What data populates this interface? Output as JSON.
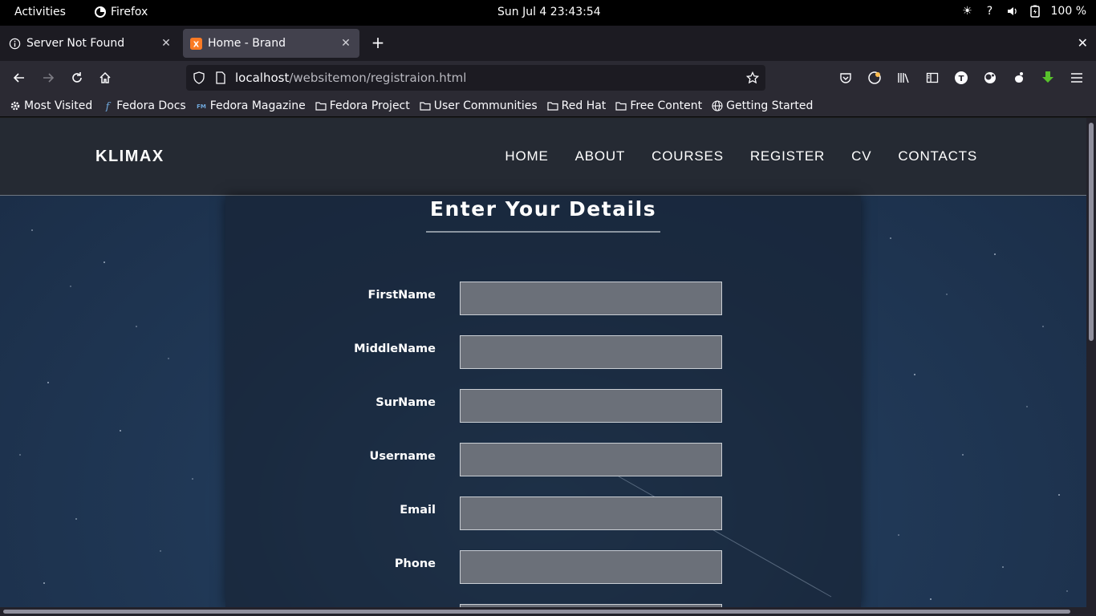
{
  "system_bar": {
    "activities": "Activities",
    "app_name": "Firefox",
    "clock": "Sun Jul 4  23:43:54",
    "battery": "100 %"
  },
  "browser": {
    "tabs": [
      {
        "title": "Server Not Found",
        "active": false
      },
      {
        "title": "Home - Brand",
        "active": true
      }
    ],
    "url_host": "localhost",
    "url_path": "/websitemon/registraion.html",
    "bookmarks": [
      {
        "label": "Most Visited",
        "icon": "gear-icon"
      },
      {
        "label": "Fedora Docs",
        "icon": "fedora-icon"
      },
      {
        "label": "Fedora Magazine",
        "icon": "fm-icon"
      },
      {
        "label": "Fedora Project",
        "icon": "folder-icon"
      },
      {
        "label": "User Communities",
        "icon": "folder-icon"
      },
      {
        "label": "Red Hat",
        "icon": "folder-icon"
      },
      {
        "label": "Free Content",
        "icon": "folder-icon"
      },
      {
        "label": "Getting Started",
        "icon": "globe-icon"
      }
    ]
  },
  "site": {
    "brand": "KLIMAX",
    "menu": [
      "HOME",
      "ABOUT",
      "COURSES",
      "REGISTER",
      "CV",
      "CONTACTS"
    ],
    "form_title": "Enter Your Details",
    "fields": [
      {
        "label": "FirstName",
        "value": ""
      },
      {
        "label": "MiddleName",
        "value": ""
      },
      {
        "label": "SurName",
        "value": ""
      },
      {
        "label": "Username",
        "value": ""
      },
      {
        "label": "Email",
        "value": ""
      },
      {
        "label": "Phone",
        "value": ""
      }
    ]
  },
  "colors": {
    "site_nav_bg": "#252a33",
    "input_bg": "#6b7079",
    "browser_chrome": "#2b2a33"
  }
}
